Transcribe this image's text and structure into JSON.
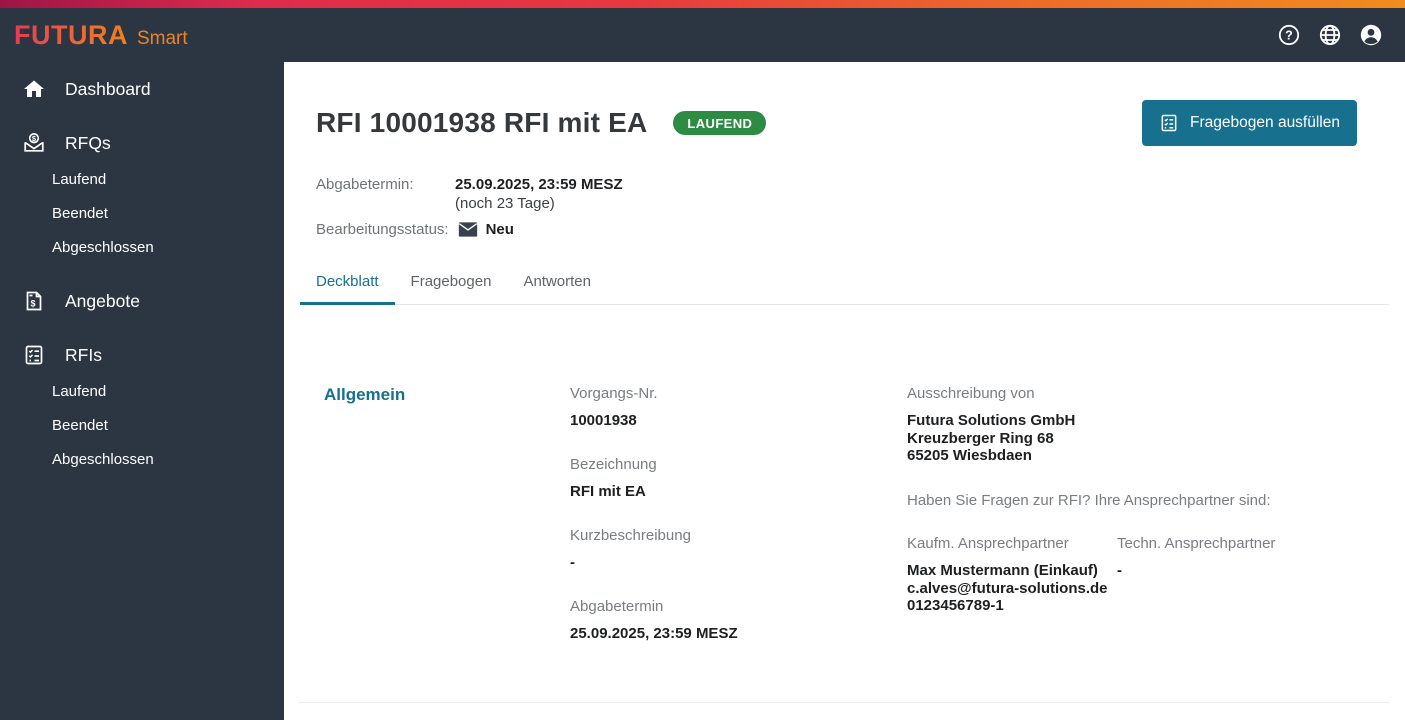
{
  "colors": {
    "header_bg": "#2b3642",
    "stripe_left": "#9e1546",
    "stripe_right": "#f18c1f",
    "accent_teal": "#16708e",
    "badge_green": "#2e8b43",
    "label_gray": "#797d81",
    "text_dark": "#1d1f21"
  },
  "header": {
    "logo_primary": "FUTURA",
    "logo_secondary": "Smart",
    "icons": [
      "help-icon",
      "language-globe-icon",
      "account-icon"
    ]
  },
  "sidebar": {
    "items": [
      {
        "label": "Dashboard",
        "icon": "home-icon"
      },
      {
        "label": "RFQs",
        "icon": "rfq-envelope-dollar-icon",
        "children": [
          "Laufend",
          "Beendet",
          "Abgeschlossen"
        ]
      },
      {
        "label": "Angebote",
        "icon": "offer-receipt-dollar-icon"
      },
      {
        "label": "RFIs",
        "icon": "rfi-checklist-icon",
        "children": [
          "Laufend",
          "Beendet",
          "Abgeschlossen"
        ]
      }
    ]
  },
  "main": {
    "title": "RFI 10001938 RFI mit EA",
    "status_badge": "LAUFEND",
    "action_button": "Fragebogen ausfüllen",
    "meta": {
      "deadline_label": "Abgabetermin:",
      "deadline_value": "25.09.2025, 23:59 MESZ",
      "deadline_note": "(noch 23 Tage)",
      "status_label": "Bearbeitungsstatus:",
      "status_value": "Neu"
    },
    "tabs": [
      "Deckblatt",
      "Fragebogen",
      "Antworten"
    ],
    "active_tab": "Deckblatt",
    "section": {
      "heading": "Allgemein",
      "fields": [
        {
          "label": "Vorgangs-Nr.",
          "value": "10001938"
        },
        {
          "label": "Bezeichnung",
          "value": "RFI mit EA"
        },
        {
          "label": "Kurzbeschreibung",
          "value": "-"
        },
        {
          "label": "Abgabetermin",
          "value": "25.09.2025, 23:59 MESZ"
        }
      ],
      "issuer_label": "Ausschreibung von",
      "issuer_address": "Futura Solutions GmbH\nKreuzberger Ring 68\n65205 Wiesbdaen",
      "contact_question": "Haben Sie Fragen zur RFI? Ihre Ansprechpartner sind:",
      "contacts": [
        {
          "label": "Kaufm. Ansprechpartner",
          "value": "Max Mustermann (Einkauf)\nc.alves@futura-solutions.de\n0123456789-1"
        },
        {
          "label": "Techn. Ansprechpartner",
          "value": "-"
        }
      ]
    }
  }
}
